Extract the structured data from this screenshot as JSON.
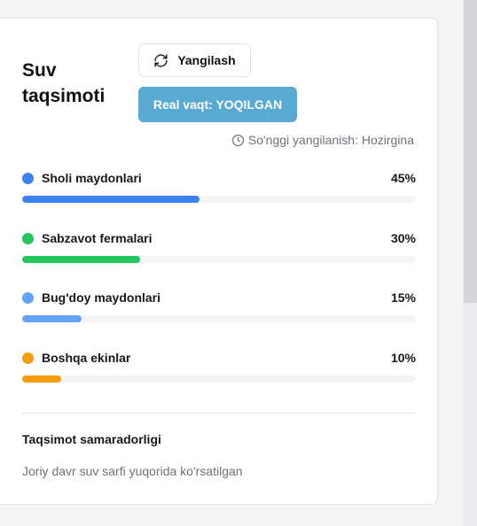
{
  "card": {
    "title": "Suv taqsimoti",
    "refresh_label": "Yangilash",
    "realtime_label": "Real vaqt: YOQILGAN",
    "last_update": "So'nggi yangilanish: Hozirgina",
    "items": [
      {
        "label": "Sholi maydonlari",
        "percent_text": "45%",
        "value": 45,
        "color": "#3b82f6"
      },
      {
        "label": "Sabzavot fermalari",
        "percent_text": "30%",
        "value": 30,
        "color": "#22c55e"
      },
      {
        "label": "Bug'doy maydonlari",
        "percent_text": "15%",
        "value": 15,
        "color": "#60a5fa"
      },
      {
        "label": "Boshqa ekinlar",
        "percent_text": "10%",
        "value": 10,
        "color": "#f59e0b"
      }
    ],
    "efficiency_title": "Taqsimot samaradorligi",
    "efficiency_desc": "Joriy davr suv sarfi yuqorida ko'rsatilgan"
  },
  "icons": {
    "refresh": "refresh-icon",
    "clock": "clock-icon"
  }
}
